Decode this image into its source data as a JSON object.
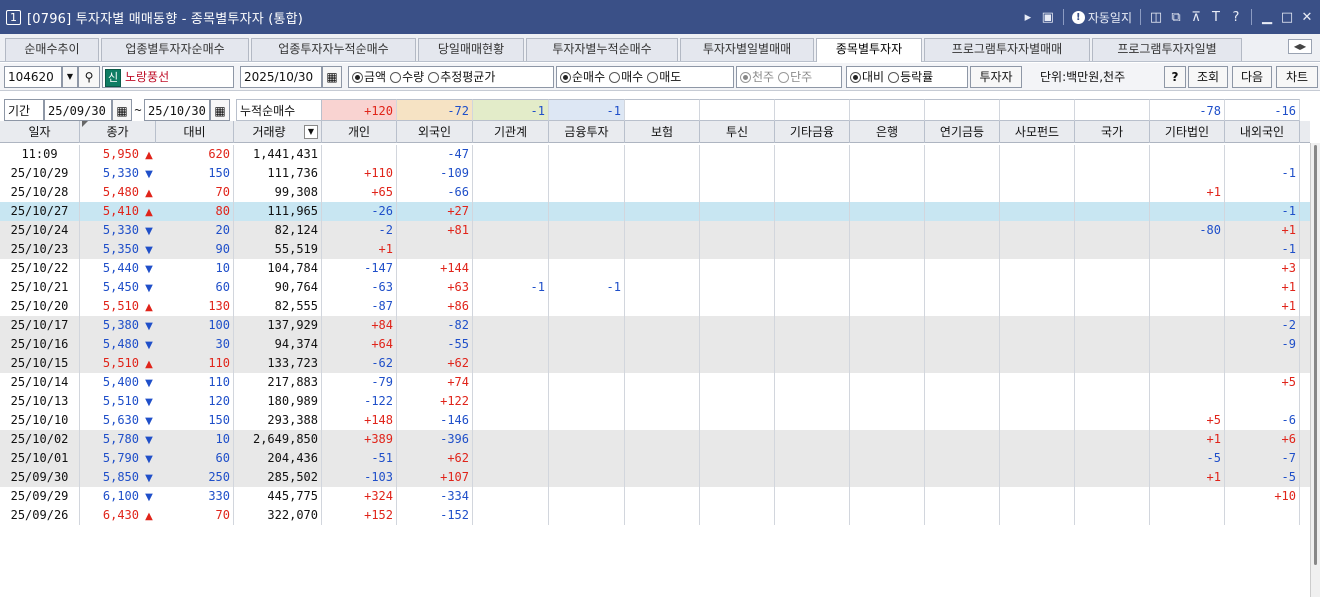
{
  "window": {
    "number": "1",
    "title": "[0796] 투자자별 매매동향 - 종목별투자자 (통합)",
    "autolog_label": "자동일지"
  },
  "tabs": [
    "순매수추이",
    "업종별투자자순매수",
    "업종투자자누적순매수",
    "당일매매현황",
    "투자자별누적순매수",
    "투자자별일별매매",
    "종목별투자자",
    "프로그램투자자별매매",
    "프로그램투자자일별"
  ],
  "active_tab": "종목별투자자",
  "controls": {
    "stock_code": "104620",
    "sin_badge": "신",
    "stock_name": "노랑풍선",
    "date": "2025/10/30",
    "radio_amount": [
      "금액",
      "수량",
      "추정평균가"
    ],
    "radio_trade": [
      "순매수",
      "매수",
      "매도"
    ],
    "radio_unit": [
      "천주",
      "단주"
    ],
    "radio_compare": [
      "대비",
      "등락률"
    ],
    "investor_button": "투자자",
    "unit_label": "단위:백만원,천주",
    "help_button": "?",
    "query_button": "조회",
    "next_button": "다음",
    "chart_button": "차트"
  },
  "period": {
    "label": "기간",
    "from": "25/09/30",
    "tilde": "~",
    "to": "25/10/30",
    "cumulative_label": "누적순매수"
  },
  "summary": {
    "individual": "+120",
    "foreign": "-72",
    "institution": "-1",
    "financial": "-1",
    "other_corp": "-78",
    "domestic_foreign": "-16"
  },
  "headers": [
    "일자",
    "종가",
    "대비",
    "거래량",
    "개인",
    "외국인",
    "기관계",
    "금융투자",
    "보험",
    "투신",
    "기타금융",
    "은행",
    "연기금등",
    "사모펀드",
    "국가",
    "기타법인",
    "내외국인"
  ],
  "rows": [
    {
      "date": "11:09",
      "close": "5,950",
      "dir": "up",
      "chg": "620",
      "vol": "1,441,431",
      "ind": "",
      "fgn": "-47",
      "inst": "",
      "fin": "",
      "corp": "",
      "dom": "",
      "style": ""
    },
    {
      "date": "25/10/29",
      "close": "5,330",
      "dir": "dn",
      "chg": "150",
      "vol": "111,736",
      "ind": "+110",
      "fgn": "-109",
      "inst": "",
      "fin": "",
      "corp": "",
      "dom": "-1",
      "style": ""
    },
    {
      "date": "25/10/28",
      "close": "5,480",
      "dir": "up",
      "chg": "70",
      "vol": "99,308",
      "ind": "+65",
      "fgn": "-66",
      "inst": "",
      "fin": "",
      "corp": "+1",
      "dom": "",
      "style": ""
    },
    {
      "date": "25/10/27",
      "close": "5,410",
      "dir": "up",
      "chg": "80",
      "vol": "111,965",
      "ind": "-26",
      "fgn": "+27",
      "inst": "",
      "fin": "",
      "corp": "",
      "dom": "-1",
      "style": "hl"
    },
    {
      "date": "25/10/24",
      "close": "5,330",
      "dir": "dn",
      "chg": "20",
      "vol": "82,124",
      "ind": "-2",
      "fgn": "+81",
      "inst": "",
      "fin": "",
      "corp": "-80",
      "dom": "+1",
      "style": "alt"
    },
    {
      "date": "25/10/23",
      "close": "5,350",
      "dir": "dn",
      "chg": "90",
      "vol": "55,519",
      "ind": "+1",
      "fgn": "",
      "inst": "",
      "fin": "",
      "corp": "",
      "dom": "-1",
      "style": "alt"
    },
    {
      "date": "25/10/22",
      "close": "5,440",
      "dir": "dn",
      "chg": "10",
      "vol": "104,784",
      "ind": "-147",
      "fgn": "+144",
      "inst": "",
      "fin": "",
      "corp": "",
      "dom": "+3",
      "style": ""
    },
    {
      "date": "25/10/21",
      "close": "5,450",
      "dir": "dn",
      "chg": "60",
      "vol": "90,764",
      "ind": "-63",
      "fgn": "+63",
      "inst": "-1",
      "fin": "-1",
      "corp": "",
      "dom": "+1",
      "style": ""
    },
    {
      "date": "25/10/20",
      "close": "5,510",
      "dir": "up",
      "chg": "130",
      "vol": "82,555",
      "ind": "-87",
      "fgn": "+86",
      "inst": "",
      "fin": "",
      "corp": "",
      "dom": "+1",
      "style": ""
    },
    {
      "date": "25/10/17",
      "close": "5,380",
      "dir": "dn",
      "chg": "100",
      "vol": "137,929",
      "ind": "+84",
      "fgn": "-82",
      "inst": "",
      "fin": "",
      "corp": "",
      "dom": "-2",
      "style": "alt"
    },
    {
      "date": "25/10/16",
      "close": "5,480",
      "dir": "dn",
      "chg": "30",
      "vol": "94,374",
      "ind": "+64",
      "fgn": "-55",
      "inst": "",
      "fin": "",
      "corp": "",
      "dom": "-9",
      "style": "alt"
    },
    {
      "date": "25/10/15",
      "close": "5,510",
      "dir": "up",
      "chg": "110",
      "vol": "133,723",
      "ind": "-62",
      "fgn": "+62",
      "inst": "",
      "fin": "",
      "corp": "",
      "dom": "",
      "style": "alt"
    },
    {
      "date": "25/10/14",
      "close": "5,400",
      "dir": "dn",
      "chg": "110",
      "vol": "217,883",
      "ind": "-79",
      "fgn": "+74",
      "inst": "",
      "fin": "",
      "corp": "",
      "dom": "+5",
      "style": ""
    },
    {
      "date": "25/10/13",
      "close": "5,510",
      "dir": "dn",
      "chg": "120",
      "vol": "180,989",
      "ind": "-122",
      "fgn": "+122",
      "inst": "",
      "fin": "",
      "corp": "",
      "dom": "",
      "style": ""
    },
    {
      "date": "25/10/10",
      "close": "5,630",
      "dir": "dn",
      "chg": "150",
      "vol": "293,388",
      "ind": "+148",
      "fgn": "-146",
      "inst": "",
      "fin": "",
      "corp": "+5",
      "dom": "-6",
      "style": ""
    },
    {
      "date": "25/10/02",
      "close": "5,780",
      "dir": "dn",
      "chg": "10",
      "vol": "2,649,850",
      "ind": "+389",
      "fgn": "-396",
      "inst": "",
      "fin": "",
      "corp": "+1",
      "dom": "+6",
      "style": "alt"
    },
    {
      "date": "25/10/01",
      "close": "5,790",
      "dir": "dn",
      "chg": "60",
      "vol": "204,436",
      "ind": "-51",
      "fgn": "+62",
      "inst": "",
      "fin": "",
      "corp": "-5",
      "dom": "-7",
      "style": "alt"
    },
    {
      "date": "25/09/30",
      "close": "5,850",
      "dir": "dn",
      "chg": "250",
      "vol": "285,502",
      "ind": "-103",
      "fgn": "+107",
      "inst": "",
      "fin": "",
      "corp": "+1",
      "dom": "-5",
      "style": "alt"
    },
    {
      "date": "25/09/29",
      "close": "6,100",
      "dir": "dn",
      "chg": "330",
      "vol": "445,775",
      "ind": "+324",
      "fgn": "-334",
      "inst": "",
      "fin": "",
      "corp": "",
      "dom": "+10",
      "style": ""
    },
    {
      "date": "25/09/26",
      "close": "6,430",
      "dir": "up",
      "chg": "70",
      "vol": "322,070",
      "ind": "+152",
      "fgn": "-152",
      "inst": "",
      "fin": "",
      "corp": "",
      "dom": "",
      "style": ""
    }
  ],
  "colors": {
    "titlebar": "#3a5087",
    "up": "#e0241a",
    "down": "#1f4fc9",
    "highlight_row": "#c8e6f2",
    "alt_row": "#e8e8e8",
    "sum_individual_bg": "#f9d3d1",
    "sum_foreign_bg": "#f6e3c4",
    "sum_institution_bg": "#e3ecc9",
    "sum_financial_bg": "#dde7f4"
  }
}
